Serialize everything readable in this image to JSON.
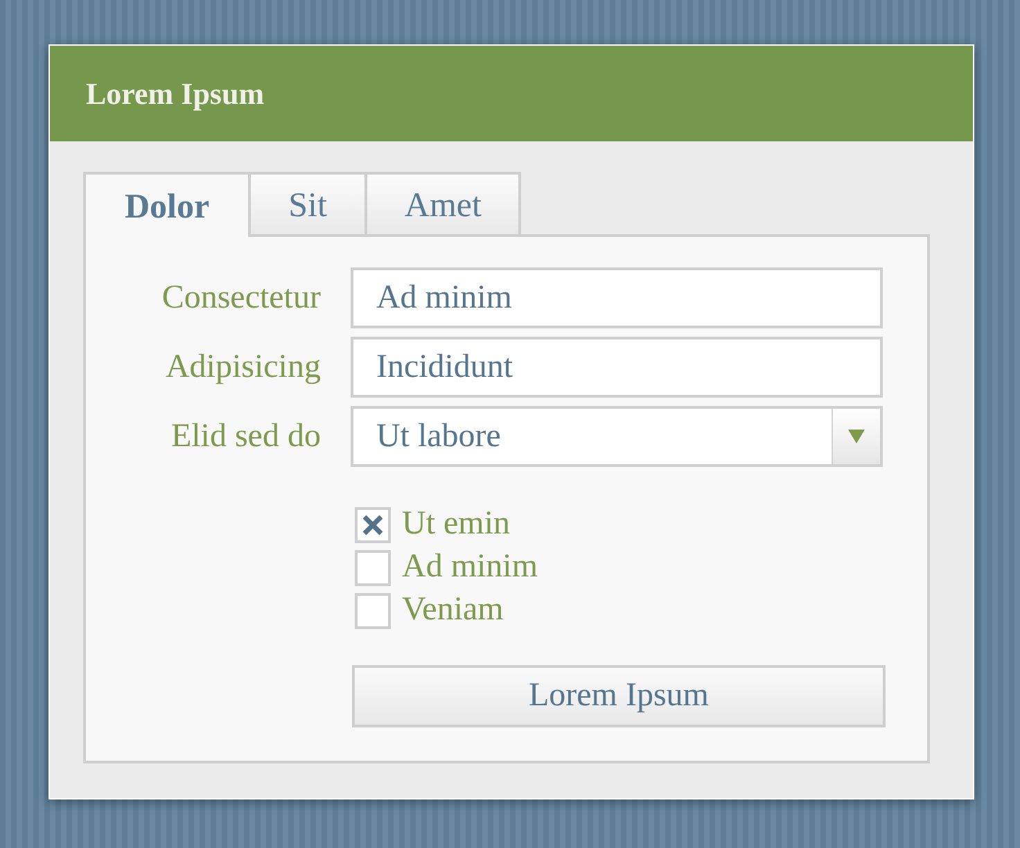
{
  "window": {
    "title": "Lorem Ipsum"
  },
  "tabs": [
    {
      "label": "Dolor",
      "selected": true
    },
    {
      "label": "Sit",
      "selected": false
    },
    {
      "label": "Amet",
      "selected": false
    }
  ],
  "fields": [
    {
      "label": "Consectetur",
      "value": "Ad minim",
      "kind": "text"
    },
    {
      "label": "Adipisicing",
      "value": "Incididunt",
      "kind": "text"
    },
    {
      "label": "Elid sed do",
      "value": "Ut labore",
      "kind": "select"
    }
  ],
  "checkboxes": [
    {
      "label": "Ut emin",
      "checked": true
    },
    {
      "label": "Ad minim",
      "checked": false
    },
    {
      "label": "Veniam",
      "checked": false
    }
  ],
  "button": "Lorem Ipsum"
}
